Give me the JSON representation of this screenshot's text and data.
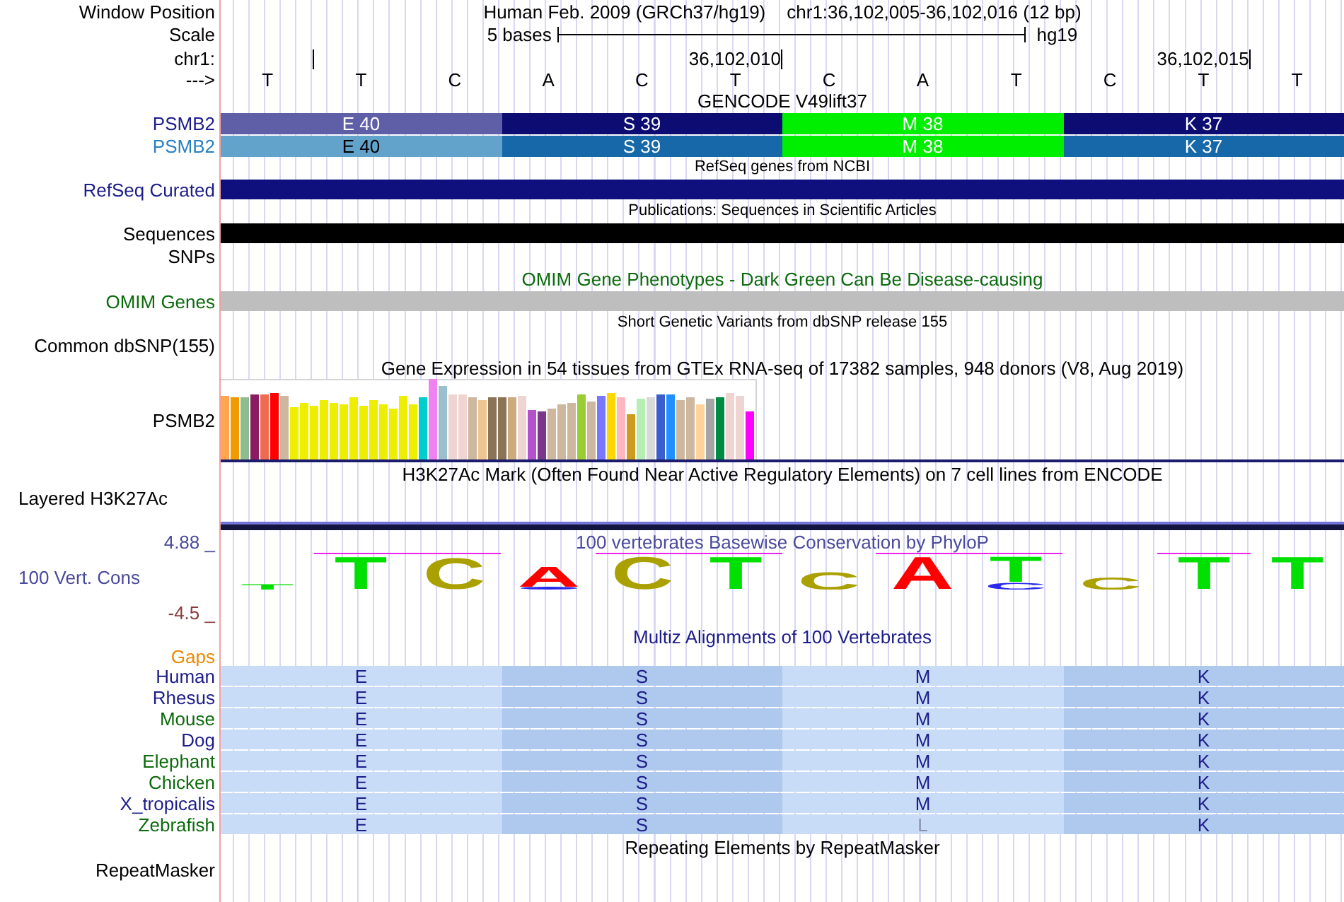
{
  "header": {
    "label": "Window Position",
    "assembly": "Human Feb. 2009 (GRCh37/hg19)",
    "position": "chr1:36,102,005-36,102,016 (12 bp)"
  },
  "scale": {
    "label": "Scale",
    "length": "5 bases",
    "assembly": "hg19"
  },
  "ruler": {
    "label": "chr1:",
    "strand": "--->"
  },
  "bases": [
    {
      "base": "T",
      "tick": true
    },
    {
      "base": "T",
      "tick": false
    },
    {
      "base": "C",
      "tick": false
    },
    {
      "base": "A",
      "tick": false
    },
    {
      "base": "C",
      "tick": false
    },
    {
      "base": "T",
      "tick": true,
      "tick_label": "36,102,010"
    },
    {
      "base": "C",
      "tick": false
    },
    {
      "base": "A",
      "tick": false
    },
    {
      "base": "T",
      "tick": false
    },
    {
      "base": "C",
      "tick": false
    },
    {
      "base": "T",
      "tick": true,
      "tick_label": "36,102,015"
    },
    {
      "base": "T",
      "tick": false
    }
  ],
  "tracks": [
    {
      "kind": "title",
      "text": "GENCODE V49lift37",
      "color": "#000000"
    },
    {
      "kind": "gene",
      "label": "PSMB2",
      "color": "#1c1c8a",
      "segments": [
        {
          "text": "E 40",
          "color": "#5f5fa8",
          "dark_text": false
        },
        {
          "text": "S 39",
          "color": "#0c0c72",
          "dark_text": false
        },
        {
          "text": "M 38",
          "color": "#00ee00",
          "dark_text": false
        },
        {
          "text": "K 37",
          "color": "#0c0c72",
          "dark_text": false
        }
      ]
    },
    {
      "kind": "gene",
      "label": "PSMB2",
      "color": "#2a7fc0",
      "segments": [
        {
          "text": "E 40",
          "color": "#62a3cc",
          "dark_text": true
        },
        {
          "text": "S 39",
          "color": "#1668a8",
          "dark_text": false
        },
        {
          "text": "M 38",
          "color": "#00ee00",
          "dark_text": false
        },
        {
          "text": "K 37",
          "color": "#1668a8",
          "dark_text": false
        }
      ]
    },
    {
      "kind": "caption",
      "text": "RefSeq genes from NCBI",
      "color": "#000000"
    },
    {
      "kind": "bar",
      "label": "RefSeq Curated",
      "color": "#1c1c8a",
      "bar": {
        "color": "#0f0f7e"
      }
    },
    {
      "kind": "caption",
      "text": "Publications: Sequences in Scientific Articles",
      "color": "#000000"
    },
    {
      "kind": "bar",
      "label": "Sequences",
      "color": "#000000",
      "bar": {
        "color": "#000000"
      }
    },
    {
      "kind": "empty",
      "label": "SNPs",
      "color": "#000000"
    },
    {
      "kind": "title",
      "text": "OMIM Gene Phenotypes - Dark Green Can Be Disease-causing",
      "color": "#0b6b0b"
    },
    {
      "kind": "bar",
      "label": "OMIM Genes",
      "color": "#0b6b0b",
      "bar": {
        "color": "#bebebe"
      }
    },
    {
      "kind": "caption",
      "text": "Short Genetic Variants from dbSNP release 155",
      "color": "#000000"
    },
    {
      "kind": "empty",
      "label": "Common dbSNP(155)",
      "color": "#000000"
    },
    {
      "kind": "title",
      "text": "Gene Expression in 54 tissues from GTEx RNA-seq of 17382 samples, 948 donors (V8, Aug 2019)",
      "color": "#000000"
    },
    {
      "kind": "expression",
      "label": "PSMB2",
      "color": "#000000"
    },
    {
      "kind": "title",
      "text": "H3K27Ac Mark (Often Found Near Active Regulatory Elements) on 7 cell lines from ENCODE",
      "color": "#000000"
    },
    {
      "kind": "layered",
      "label": "Layered H3K27Ac",
      "color": "#000000"
    },
    {
      "kind": "conservation",
      "title": "100 vertebrates Basewise Conservation by PhyloP",
      "color": "#4a4a9c",
      "label": "100 Vert. Cons",
      "max": "4.88 _",
      "min": "-4.5 _",
      "logo": [
        {
          "overline": false,
          "stack": [
            {
              "kind": "letter",
              "base": "T",
              "color": "#00e000"
            }
          ]
        },
        {
          "overline": true,
          "stack": [
            {
              "kind": "letter",
              "base": "T",
              "color": "#00e000"
            }
          ]
        },
        {
          "overline": true,
          "stack": [
            {
              "kind": "letter",
              "base": "C",
              "color": "#aaa000"
            }
          ]
        },
        {
          "overline": false,
          "stack": [
            {
              "kind": "letter",
              "base": "A",
              "color": "#ff0000"
            },
            {
              "kind": "sliver",
              "color": "#2a2aee"
            }
          ]
        },
        {
          "overline": true,
          "stack": [
            {
              "kind": "letter",
              "base": "C",
              "color": "#aaa000"
            }
          ]
        },
        {
          "overline": true,
          "stack": [
            {
              "kind": "letter",
              "base": "T",
              "color": "#00e000"
            }
          ]
        },
        {
          "overline": false,
          "stack": [
            {
              "kind": "letter",
              "base": "C",
              "color": "#aaa000"
            }
          ]
        },
        {
          "overline": true,
          "stack": [
            {
              "kind": "letter",
              "base": "A",
              "color": "#ff0000"
            }
          ]
        },
        {
          "overline": true,
          "stack": [
            {
              "kind": "letter",
              "base": "T",
              "color": "#00e000"
            },
            {
              "kind": "letter",
              "base": "C",
              "color": "#2a2aee"
            }
          ]
        },
        {
          "overline": false,
          "stack": [
            {
              "kind": "letter",
              "base": "C",
              "color": "#aaa000"
            }
          ]
        },
        {
          "overline": true,
          "stack": [
            {
              "kind": "letter",
              "base": "T",
              "color": "#00e000"
            }
          ]
        },
        {
          "overline": false,
          "stack": [
            {
              "kind": "letter",
              "base": "T",
              "color": "#00e000"
            }
          ]
        }
      ]
    },
    {
      "kind": "title",
      "text": "Multiz Alignments of 100 Vertebrates",
      "color": "#1c1c8a"
    },
    {
      "kind": "gaps",
      "label": "Gaps",
      "color": "#ee8a00"
    },
    {
      "kind": "alignment",
      "label": "Human",
      "color": "#1c1c8a",
      "cells": [
        {
          "aa": "E",
          "match": true
        },
        {
          "aa": "S",
          "match": true
        },
        {
          "aa": "M",
          "match": true
        },
        {
          "aa": "K",
          "match": true
        }
      ]
    },
    {
      "kind": "alignment",
      "label": "Rhesus",
      "color": "#1c1c8a",
      "cells": [
        {
          "aa": "E",
          "match": true
        },
        {
          "aa": "S",
          "match": true
        },
        {
          "aa": "M",
          "match": true
        },
        {
          "aa": "K",
          "match": true
        }
      ]
    },
    {
      "kind": "alignment",
      "label": "Mouse",
      "color": "#0b6b0b",
      "cells": [
        {
          "aa": "E",
          "match": true
        },
        {
          "aa": "S",
          "match": true
        },
        {
          "aa": "M",
          "match": true
        },
        {
          "aa": "K",
          "match": true
        }
      ]
    },
    {
      "kind": "alignment",
      "label": "Dog",
      "color": "#1c1c8a",
      "cells": [
        {
          "aa": "E",
          "match": true
        },
        {
          "aa": "S",
          "match": true
        },
        {
          "aa": "M",
          "match": true
        },
        {
          "aa": "K",
          "match": true
        }
      ]
    },
    {
      "kind": "alignment",
      "label": "Elephant",
      "color": "#0b6b0b",
      "cells": [
        {
          "aa": "E",
          "match": true
        },
        {
          "aa": "S",
          "match": true
        },
        {
          "aa": "M",
          "match": true
        },
        {
          "aa": "K",
          "match": true
        }
      ]
    },
    {
      "kind": "alignment",
      "label": "Chicken",
      "color": "#0b6b0b",
      "cells": [
        {
          "aa": "E",
          "match": true
        },
        {
          "aa": "S",
          "match": true
        },
        {
          "aa": "M",
          "match": true
        },
        {
          "aa": "K",
          "match": true
        }
      ]
    },
    {
      "kind": "alignment",
      "label": "X_tropicalis",
      "color": "#1c1c8a",
      "cells": [
        {
          "aa": "E",
          "match": true
        },
        {
          "aa": "S",
          "match": true
        },
        {
          "aa": "M",
          "match": true
        },
        {
          "aa": "K",
          "match": true
        }
      ]
    },
    {
      "kind": "alignment",
      "label": "Zebrafish",
      "color": "#0b6b0b",
      "cells": [
        {
          "aa": "E",
          "match": true
        },
        {
          "aa": "S",
          "match": true
        },
        {
          "aa": "L",
          "match": false
        },
        {
          "aa": "K",
          "match": true
        }
      ]
    },
    {
      "kind": "title",
      "text": "Repeating Elements by RepeatMasker",
      "color": "#000000"
    },
    {
      "kind": "empty",
      "label": "RepeatMasker",
      "color": "#000000"
    }
  ]
}
